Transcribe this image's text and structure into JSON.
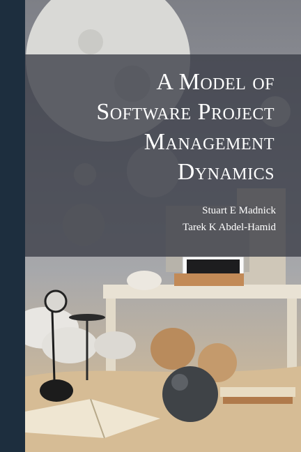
{
  "book": {
    "title_lines": [
      "A Model of",
      "Software Project",
      "Management",
      "Dynamics"
    ],
    "authors": [
      "Stuart E Madnick",
      "Tarek K Abdel-Hamid"
    ]
  },
  "colors": {
    "spine": "#1d2e3e",
    "title_band": "#3a3c46",
    "text": "#ffffff"
  }
}
